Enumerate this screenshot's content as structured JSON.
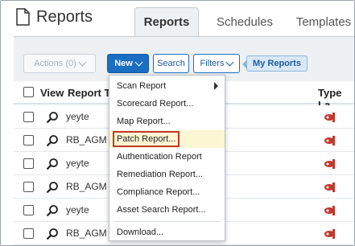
{
  "header": {
    "title": "Reports",
    "tabs": [
      {
        "label": "Reports",
        "active": true
      },
      {
        "label": "Schedules",
        "active": false
      },
      {
        "label": "Templates",
        "active": false
      }
    ]
  },
  "toolbar": {
    "actions_label": "Actions (0)",
    "new_label": "New",
    "search_label": "Search",
    "filters_label": "Filters",
    "my_reports_label": "My Reports"
  },
  "table": {
    "columns": {
      "view": "View",
      "report_title": "Report T",
      "type": "Type La"
    },
    "rows": [
      {
        "name": "yeyte"
      },
      {
        "name": "RB_AGM"
      },
      {
        "name": "yeyte"
      },
      {
        "name": "RB_AGM"
      },
      {
        "name": "yeyte"
      },
      {
        "name": "RB_AGM"
      }
    ]
  },
  "new_menu": {
    "items": [
      {
        "label": "Scan Report",
        "has_submenu": true
      },
      {
        "label": "Scorecard Report..."
      },
      {
        "label": "Map Report..."
      },
      {
        "label": "Patch Report...",
        "highlighted": true
      },
      {
        "label": "Authentication Report"
      },
      {
        "label": "Remediation Report..."
      },
      {
        "label": "Compliance Report..."
      },
      {
        "label": "Asset Search Report..."
      }
    ],
    "footer_item": "Download..."
  },
  "colors": {
    "primary": "#1b6ec2",
    "panel_bg": "#eef1f4",
    "highlight_bg": "#fdf6d3",
    "highlight_border": "#c0392b",
    "type_icon": "#c0392b"
  }
}
